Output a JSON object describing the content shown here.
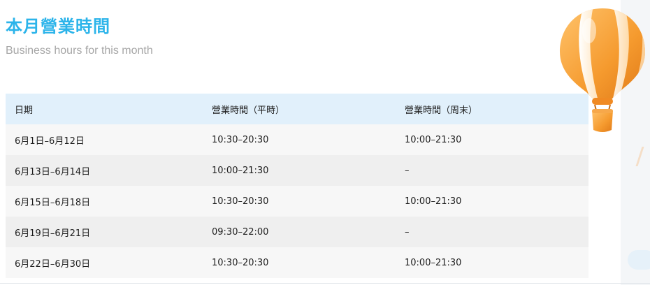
{
  "header": {
    "title": "本月營業時間",
    "subtitle": "Business hours for this month"
  },
  "table": {
    "columns": [
      "日期",
      "營業時間（平時）",
      "營業時間（周末）"
    ],
    "rows": [
      {
        "date": "6月1日–6月12日",
        "weekday": "10:30–20:30",
        "weekend": "10:00–21:30"
      },
      {
        "date": "6月13日–6月14日",
        "weekday": "10:00–21:30",
        "weekend": "–"
      },
      {
        "date": "6月15日–6月18日",
        "weekday": "10:30–20:30",
        "weekend": "10:00–21:30"
      },
      {
        "date": "6月19日–6月21日",
        "weekday": "09:30–22:00",
        "weekend": "–"
      },
      {
        "date": "6月22日–6月30日",
        "weekday": "10:30–20:30",
        "weekend": "10:00–21:30"
      }
    ]
  },
  "colors": {
    "title": "#2cb4ea",
    "subtitle": "#a6a6a6",
    "header_row": "#e1f0fb",
    "row_light": "#f7f7f7",
    "row_dark": "#efefef",
    "balloon_orange": "#f59a2e",
    "balloon_cream": "#fff3e0"
  },
  "decoration": {
    "illustration": "hot-air-balloon-icon"
  }
}
